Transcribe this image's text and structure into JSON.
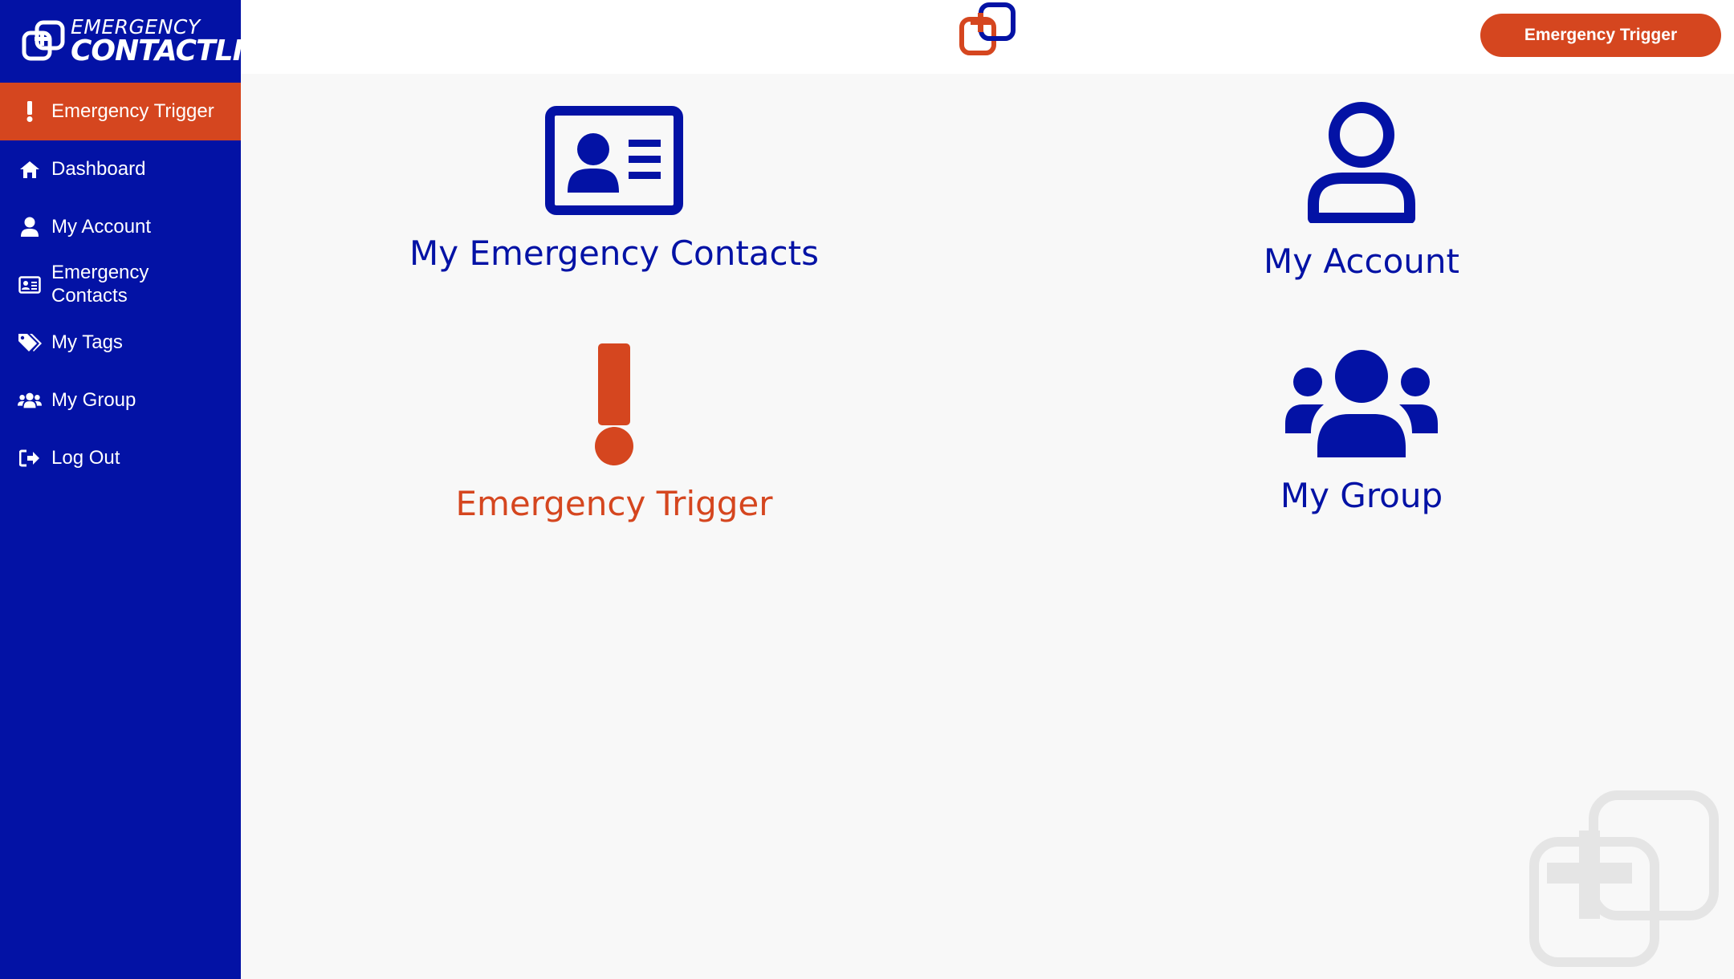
{
  "brand": {
    "line1": "EMERGENCY",
    "line2": "CONTACTLINK"
  },
  "sidebar": {
    "items": [
      {
        "label": "Emergency Trigger",
        "icon": "exclamation-icon",
        "active": true
      },
      {
        "label": "Dashboard",
        "icon": "home-icon"
      },
      {
        "label": "My Account",
        "icon": "user-icon"
      },
      {
        "label": "Emergency Contacts",
        "icon": "id-card-icon"
      },
      {
        "label": "My Tags",
        "icon": "tags-icon"
      },
      {
        "label": "My Group",
        "icon": "users-icon"
      },
      {
        "label": "Log Out",
        "icon": "sign-out-icon"
      }
    ]
  },
  "topbar": {
    "button_label": "Emergency Trigger"
  },
  "tiles": {
    "contacts": {
      "label": "My Emergency Contacts",
      "icon": "id-card-icon"
    },
    "account": {
      "label": "My Account",
      "icon": "user-icon"
    },
    "trigger": {
      "label": "Emergency Trigger",
      "icon": "exclamation-icon"
    },
    "group": {
      "label": "My Group",
      "icon": "users-icon"
    }
  },
  "colors": {
    "primary": "#0312a5",
    "accent": "#d5461f",
    "background": "#f8f8f8"
  }
}
